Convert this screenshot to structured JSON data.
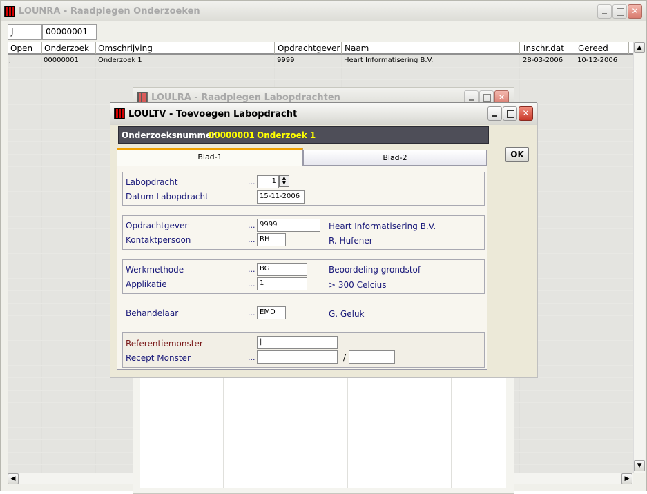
{
  "main_window": {
    "title": "LOUNRA - Raadplegen Onderzoeken",
    "filter_open": "J",
    "filter_onderzoek": "00000001",
    "columns": [
      "Open",
      "Onderzoek",
      "Omschrijving",
      "Opdrachtgever",
      "Naam",
      "Inschr.dat",
      "Gereed"
    ],
    "rows": [
      [
        "J",
        "00000001",
        "Onderzoek 1",
        "9999",
        "Heart Informatisering B.V.",
        "28-03-2006",
        "10-12-2006"
      ]
    ]
  },
  "background_window": {
    "title": "LOULRA - Raadplegen Labopdrachten"
  },
  "dialog": {
    "title": "LOULTV - Toevoegen Labopdracht",
    "header_label": "Onderzoeksnummer",
    "header_number": "00000001",
    "header_name": "Onderzoek 1",
    "ok_label": "OK",
    "tabs": [
      "Blad-1",
      "Blad-2"
    ],
    "dots": "...",
    "labopdracht_label": "Labopdracht",
    "labopdracht_value": "1",
    "datum_label": "Datum Labopdracht",
    "datum_value": "15-11-2006",
    "opdrachtgever_label": "Opdrachtgever",
    "opdrachtgever_value": "9999",
    "opdrachtgever_desc": "Heart Informatisering B.V.",
    "kontaktpersoon_label": "Kontaktpersoon",
    "kontaktpersoon_value": "RH",
    "kontaktpersoon_desc": "R. Hufener",
    "werkmethode_label": "Werkmethode",
    "werkmethode_value": "BG",
    "werkmethode_desc": "Beoordeling grondstof",
    "applikatie_label": "Applikatie",
    "applikatie_value": "1",
    "applikatie_desc": "> 300 Celcius",
    "behandelaar_label": "Behandelaar",
    "behandelaar_value": "EMD",
    "behandelaar_desc": "G. Geluk",
    "referentiemonster_label": "Referentiemonster",
    "referentiemonster_value": "|",
    "recept_label": "Recept Monster",
    "recept_value": "",
    "recept_sep": "/",
    "recept_value2": ""
  },
  "colors": {
    "header_bg": "#4e4e58",
    "header_text": "#ffffff",
    "header_highlight": "#ffff00",
    "label_text": "#1a1a7a",
    "tab_accent": "#f0a000"
  }
}
